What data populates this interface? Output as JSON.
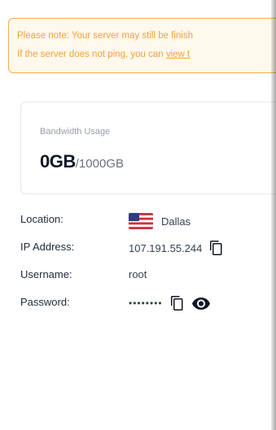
{
  "notice": {
    "line1": "Please note: Your server may still be finish",
    "line2_text": "If the server does not ping, you can ",
    "line2_link": "view t"
  },
  "bandwidth": {
    "label": "Bandwidth Usage",
    "used": "0GB",
    "total": "/1000GB"
  },
  "details": {
    "location_label": "Location:",
    "location_value": "Dallas",
    "location_flag_icon": "us-flag-icon",
    "ip_label": "IP Address:",
    "ip_value": "107.191.55.244",
    "username_label": "Username:",
    "username_value": "root",
    "password_label": "Password:",
    "password_value": "••••••••"
  },
  "icons": {
    "copy": "copy-icon",
    "show_password": "eye-icon"
  },
  "colors": {
    "notice_text": "#f0a33a",
    "notice_border": "#f5b14a",
    "notice_bg": "#fff8ec"
  }
}
